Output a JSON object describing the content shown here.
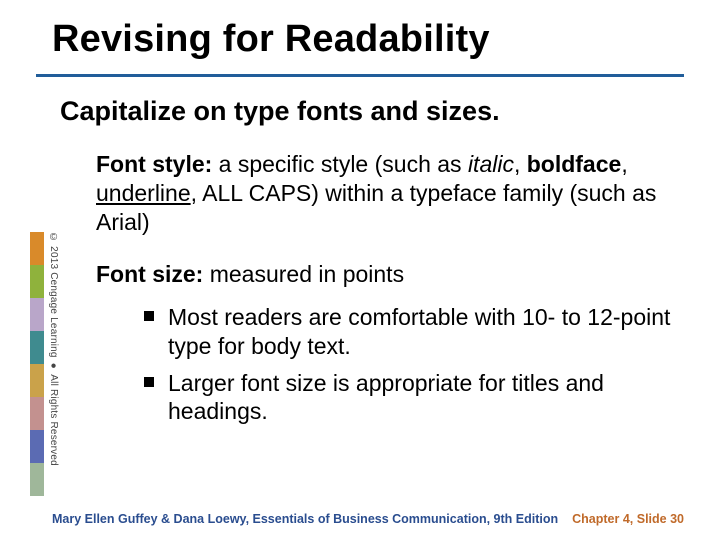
{
  "title": "Revising for Readability",
  "subtitle": "Capitalize on type fonts and sizes.",
  "para1": {
    "headLabel": "Font style:",
    "t1": " a specific style (such as ",
    "italic": "italic",
    "t2": ", ",
    "bold": "boldface",
    "t3": ", ",
    "underline": "underline",
    "t4": ", ALL CAPS) within a typeface family (such as Arial)"
  },
  "para2": {
    "headLabel": "Font size:",
    "tail": " measured in points"
  },
  "bullets": [
    "Most readers are comfortable with 10- to 12-point type for body text.",
    "Larger font size is appropriate for titles and headings."
  ],
  "sideCredit": "© 2013 Cengage Learning  ●  All Rights Reserved",
  "footer": {
    "left": "Mary Ellen Guffey & Dana Loewy, Essentials of Business Communication, 9th Edition",
    "right": "Chapter 4, Slide 30"
  }
}
